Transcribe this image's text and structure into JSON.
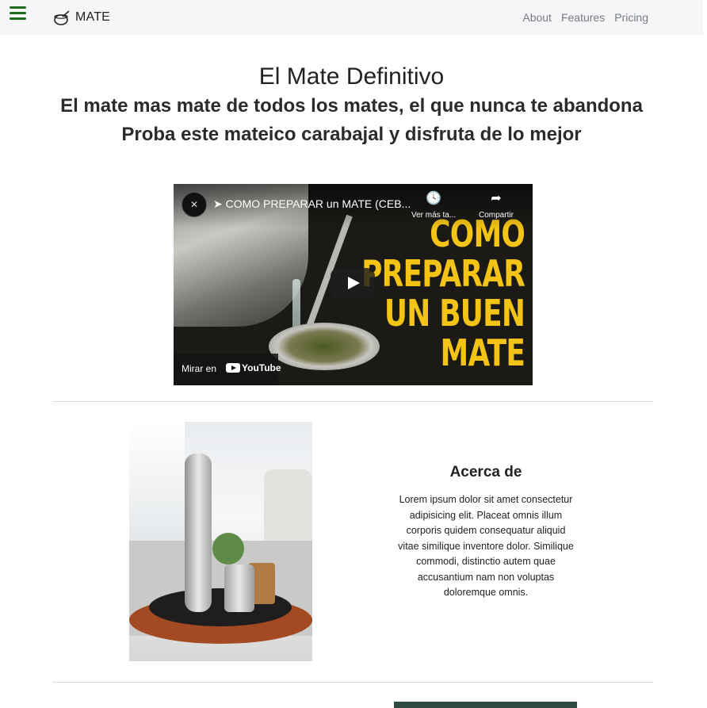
{
  "navbar": {
    "brand": "MATE",
    "links": [
      "About",
      "Features",
      "Pricing"
    ]
  },
  "hero": {
    "title": "El Mate Definitivo",
    "subtitle_1": "El mate mas mate de todos los mates, el que nunca te abandona",
    "subtitle_2": "Proba este mateico carabajal y disfruta de lo mejor"
  },
  "video": {
    "title": "➤ COMO PREPARAR un MATE (CEB...",
    "watch_later": "Ver más ta...",
    "share": "Compartir",
    "watch_on": "Mirar en",
    "youtube": "YouTube",
    "art_lines": [
      "COMO",
      "PREPARAR",
      "UN BUEN",
      "MATE"
    ]
  },
  "about": {
    "heading": "Acerca de",
    "body": "Lorem ipsum dolor sit amet consectetur adipisicing elit. Placeat omnis illum corporis quidem consequatur aliquid vitae similique inventore dolor. Similique commodi, distinctio autem quae accusantium nam non voluptas doloremque omnis."
  },
  "colors": {
    "navbar_bg": "#f5f6f8",
    "hamburger": "#1f6b1f",
    "art_yellow": "#f3c316"
  }
}
